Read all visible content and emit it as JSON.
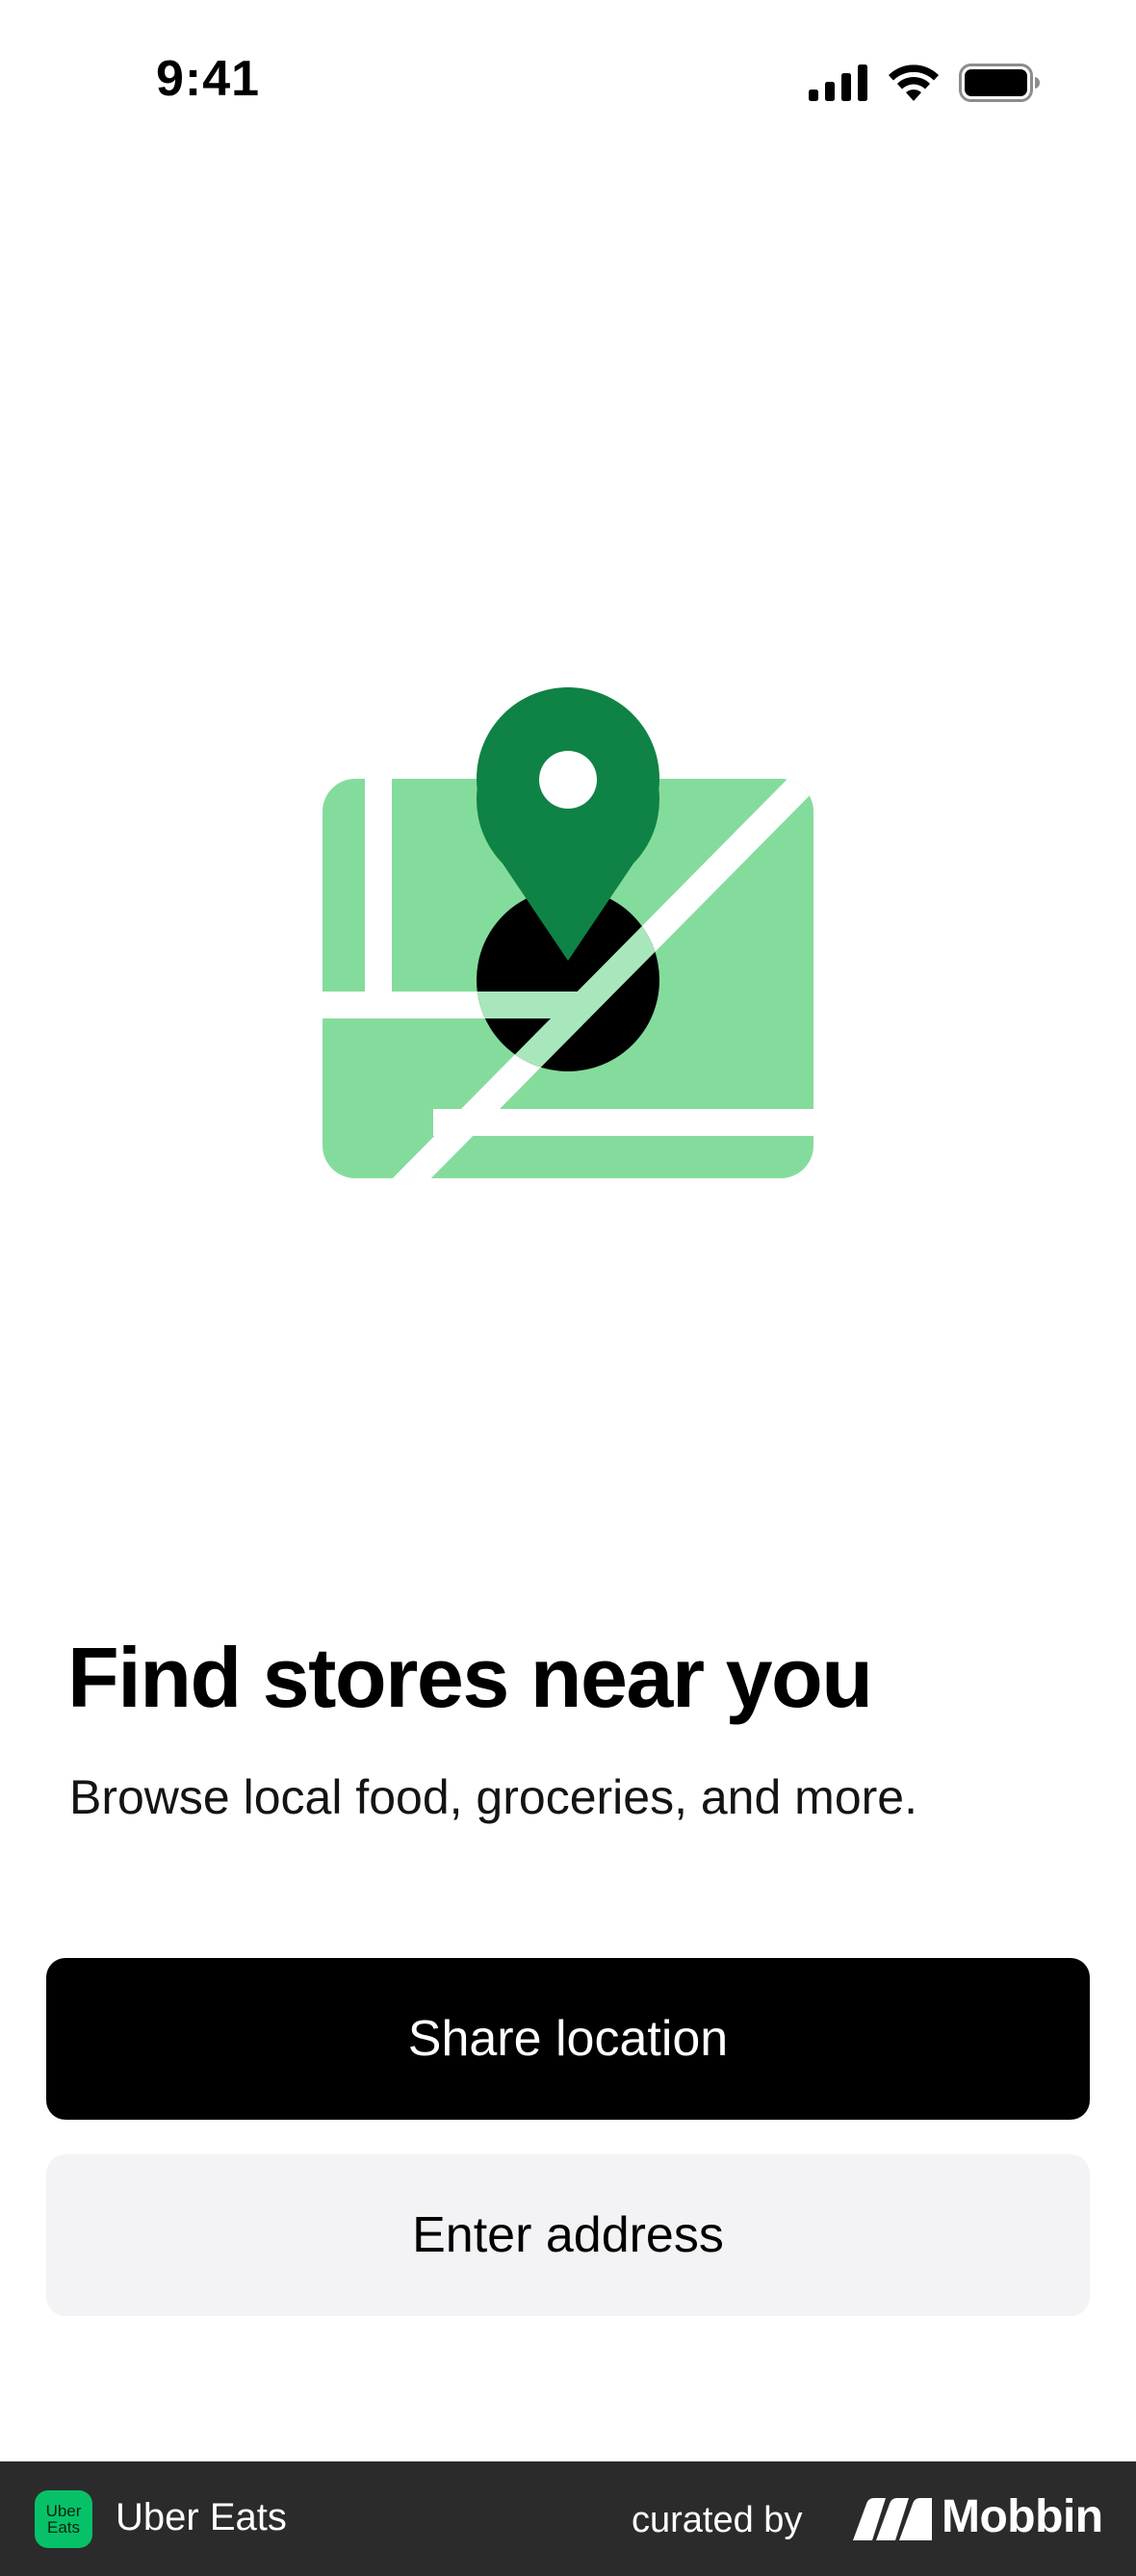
{
  "status_bar": {
    "time": "9:41",
    "icons": [
      "cellular-signal-icon",
      "wifi-icon",
      "battery-icon"
    ]
  },
  "illustration": {
    "name": "map-pin-illustration",
    "colors": {
      "map_light": "#84dc9c",
      "road": "#d8f5e0",
      "pin_green": "#0e8345",
      "pin_target": "#000000",
      "pin_hole": "#ffffff"
    }
  },
  "content": {
    "headline": "Find stores near you",
    "subtitle": "Browse local food, groceries, and more."
  },
  "actions": {
    "share_location_label": "Share location",
    "enter_address_label": "Enter address"
  },
  "footer": {
    "app_logo_line1": "Uber",
    "app_logo_line2": "Eats",
    "app_name": "Uber Eats",
    "curated_by": "curated by",
    "brand": "Mobbin"
  },
  "colors": {
    "primary_button_bg": "#000000",
    "secondary_button_bg": "#f3f2f5",
    "footer_bg": "#2b2b2b",
    "uber_eats_green": "#06c167"
  }
}
